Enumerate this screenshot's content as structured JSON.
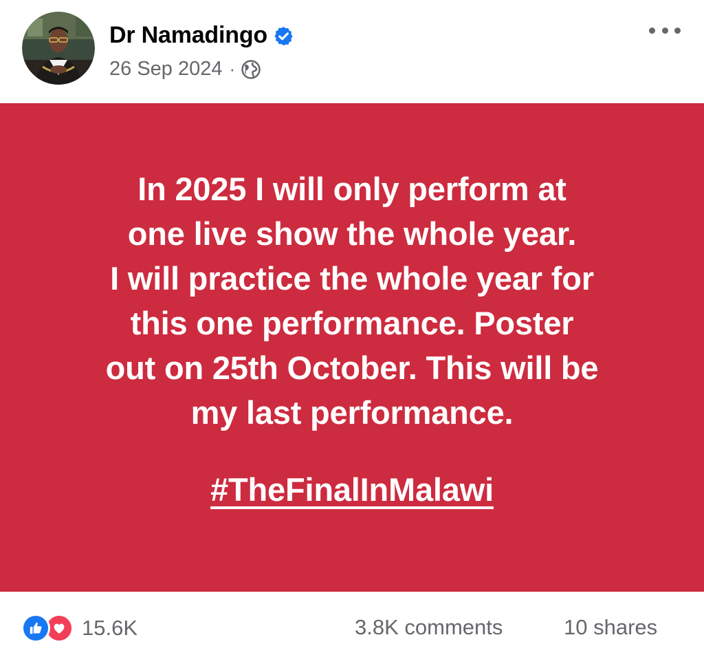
{
  "post": {
    "author": {
      "name": "Dr Namadingo",
      "verified": true
    },
    "date": "26 Sep 2024",
    "separator": "·",
    "audience_icon": "globe-icon",
    "more_icon": "more-options-icon",
    "background_color": "#cd2b3f",
    "text": "In 2025 I will only perform at\none live show the whole year.\nI will practice the whole year for\nthis one performance. Poster\nout on 25th October. This will be\nmy last performance.",
    "hashtag": "#TheFinalInMalawi"
  },
  "footer": {
    "reaction_icons": [
      "like-icon",
      "love-icon"
    ],
    "reaction_count": "15.6K",
    "comments": "3.8K comments",
    "shares": "10 shares"
  },
  "colors": {
    "verified_blue": "#1877f2",
    "like_blue": "#1877f2",
    "love_red": "#f33e58",
    "meta_gray": "#65676b"
  }
}
